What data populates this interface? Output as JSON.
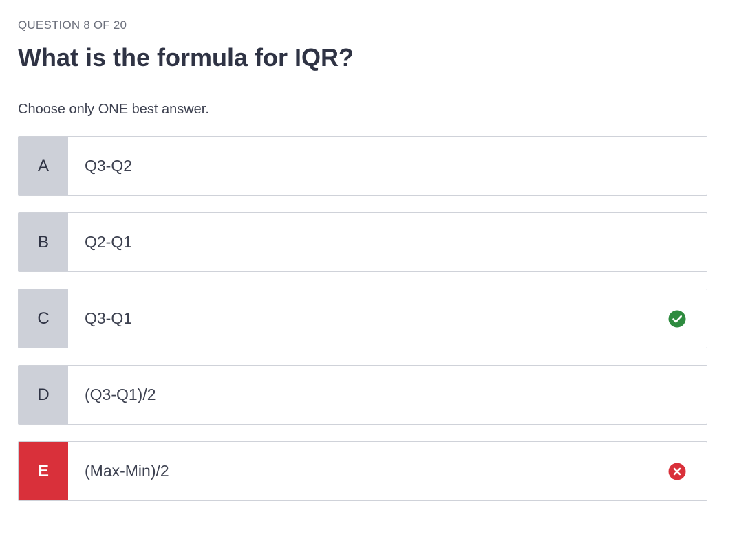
{
  "quiz": {
    "counter": "QUESTION 8 OF 20",
    "question": "What is the formula for IQR?",
    "instruction": "Choose only ONE best answer.",
    "options": [
      {
        "letter": "A",
        "text": "Q3-Q2",
        "status": "none"
      },
      {
        "letter": "B",
        "text": "Q2-Q1",
        "status": "none"
      },
      {
        "letter": "C",
        "text": "Q3-Q1",
        "status": "correct",
        "icon": "check-circle-icon"
      },
      {
        "letter": "D",
        "text": "(Q3-Q1)/2",
        "status": "none"
      },
      {
        "letter": "E",
        "text": "(Max-Min)/2",
        "status": "incorrect-selected",
        "icon": "x-circle-icon"
      }
    ]
  },
  "colors": {
    "correct": "#2e8b3f",
    "incorrect": "#d9303a",
    "letter_bg": "#cdd0d8",
    "text": "#2f3344"
  }
}
